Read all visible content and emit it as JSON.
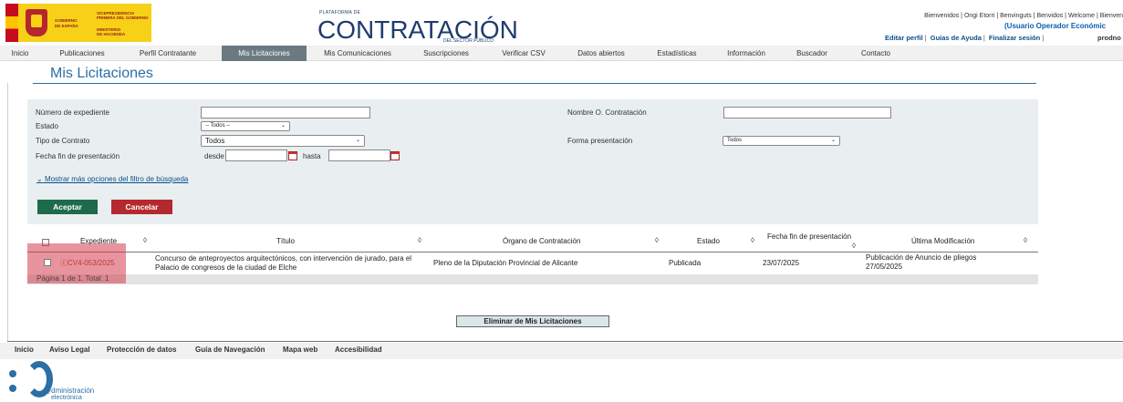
{
  "header": {
    "gov_lines_top": [
      "VICEPRESIDENCIA",
      "PRIMERA DEL GOBIERNO"
    ],
    "gov_lines_left": [
      "GOBIERNO",
      "DE ESPAÑA"
    ],
    "gov_lines_bottom": [
      "MINISTERIO",
      "DE HACIENDA"
    ],
    "platform_small": "PLATAFORMA DE",
    "platform_big": "CONTRATACIÓN",
    "platform_sub": "DEL SECTOR PÚBLICO",
    "welcome": "Bienvenidos | Ongi Etorri | Benvinguts | Benvidos | Welcome | Bienven",
    "user_role": "(Usuario Operador Económic",
    "links": [
      "Editar perfil",
      "Guías de Ayuda",
      "Finalizar sesión"
    ],
    "user_name": "prodno"
  },
  "nav": {
    "items": [
      "Inicio",
      "Publicaciones",
      "Perfil Contratante",
      "Mis Licitaciones",
      "Mis Comunicaciones",
      "Suscripciones",
      "Verificar CSV",
      "Datos abiertos",
      "Estadísticas",
      "Información",
      "Buscador",
      "Contacto"
    ],
    "active": "Mis Licitaciones"
  },
  "page": {
    "title": "Mis Licitaciones"
  },
  "filter": {
    "expediente_label": "Número de expediente",
    "expediente_value": "",
    "estado_label": "Estado",
    "estado_value": "-- Todos --",
    "tipo_label": "Tipo de Contrato",
    "tipo_value": "Todos",
    "fecha_label": "Fecha fin de presentación",
    "desde_label": "desde",
    "hasta_label": "hasta",
    "desde_value": "",
    "hasta_value": "",
    "organo_label": "Nombre O. Contratación",
    "organo_value": "",
    "forma_label": "Forma presentación",
    "forma_value": "Todos",
    "more_options": "Mostrar más opciones del filtro de búsqueda",
    "accept": "Aceptar",
    "cancel": "Cancelar",
    "accept_color": "#1d6b4a",
    "cancel_color": "#b4292e"
  },
  "table": {
    "headers": [
      "Expediente",
      "Título",
      "Órgano de Contratación",
      "Estado",
      "Fecha fin de presentación",
      "Última Modificación"
    ],
    "rows": [
      {
        "expediente": "CV4-053/2025",
        "titulo_1": "Concurso de anteproyectos arquitectónicos, con intervención de jurado, para el",
        "titulo_2": "Palacio de congresos de la ciudad de Elche",
        "organo": "Pleno de la Diputación Provincial de Alicante",
        "estado": "Publicada",
        "fecha_fin": "23/07/2025",
        "ultima_1": "Publicación de Anuncio de pliegos",
        "ultima_2": "27/05/2025"
      }
    ],
    "pagination": "Página 1 de 1. Total: 1"
  },
  "actions": {
    "eliminar": "Eliminar de Mis Licitaciones"
  },
  "footer": {
    "items": [
      "Inicio",
      "Aviso Legal",
      "Protección de datos",
      "Guía de Navegación",
      "Mapa web",
      "Accesibilidad"
    ]
  },
  "admin_logo": {
    "line1": "@dministración",
    "line2": "electrónica"
  }
}
